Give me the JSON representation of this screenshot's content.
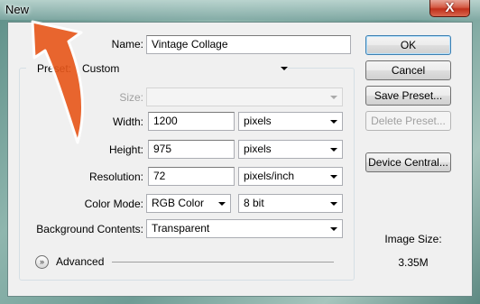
{
  "window": {
    "title": "New",
    "close_label": "X"
  },
  "form": {
    "name_label": "Name:",
    "name_value": "Vintage Collage",
    "preset_label": "Preset:",
    "preset_value": "Custom",
    "size_label": "Size:",
    "size_value": "",
    "width_label": "Width:",
    "width_value": "1200",
    "width_unit": "pixels",
    "height_label": "Height:",
    "height_value": "975",
    "height_unit": "pixels",
    "resolution_label": "Resolution:",
    "resolution_value": "72",
    "resolution_unit": "pixels/inch",
    "color_mode_label": "Color Mode:",
    "color_mode_value": "RGB Color",
    "bit_depth_value": "8 bit",
    "bg_contents_label": "Background Contents:",
    "bg_contents_value": "Transparent",
    "advanced_label": "Advanced"
  },
  "buttons": {
    "ok": "OK",
    "cancel": "Cancel",
    "save_preset": "Save Preset...",
    "delete_preset": "Delete Preset...",
    "device_central": "Device Central..."
  },
  "info": {
    "image_size_label": "Image Size:",
    "image_size_value": "3.35M"
  },
  "colors": {
    "pointer_arrow": "#e8571a",
    "close_button": "#c73a24"
  }
}
